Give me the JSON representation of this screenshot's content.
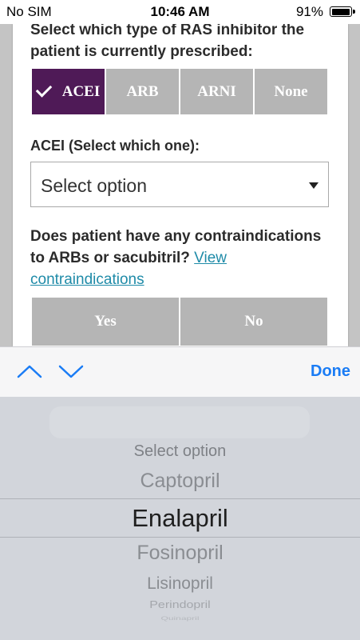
{
  "status_bar": {
    "carrier": "No SIM",
    "time": "10:46 AM",
    "battery": "91%"
  },
  "form": {
    "q1": "Select which type of RAS inhibitor the patient is currently prescribed:",
    "ras_options": [
      {
        "label": "ACEI",
        "selected": true
      },
      {
        "label": "ARB",
        "selected": false
      },
      {
        "label": "ARNI",
        "selected": false
      },
      {
        "label": "None",
        "selected": false
      }
    ],
    "acei_label": "ACEI (Select which one):",
    "acei_select_value": "Select option",
    "q3_text": "Does patient have any contraindications to ARBs or sacubitril?",
    "q3_link": "View contraindications",
    "yes_label": "Yes",
    "no_label": "No"
  },
  "toolbar": {
    "done_label": "Done"
  },
  "picker": {
    "items": [
      "Select option",
      "Captopril",
      "Enalapril",
      "Fosinopril",
      "Lisinopril",
      "Perindopril",
      "Quinapril"
    ],
    "selected_index": 2
  },
  "colors": {
    "accent": "#4f1a57",
    "link": "#1f8ba8",
    "done": "#1a7cf5",
    "inactive_button": "#b5b5b5"
  }
}
